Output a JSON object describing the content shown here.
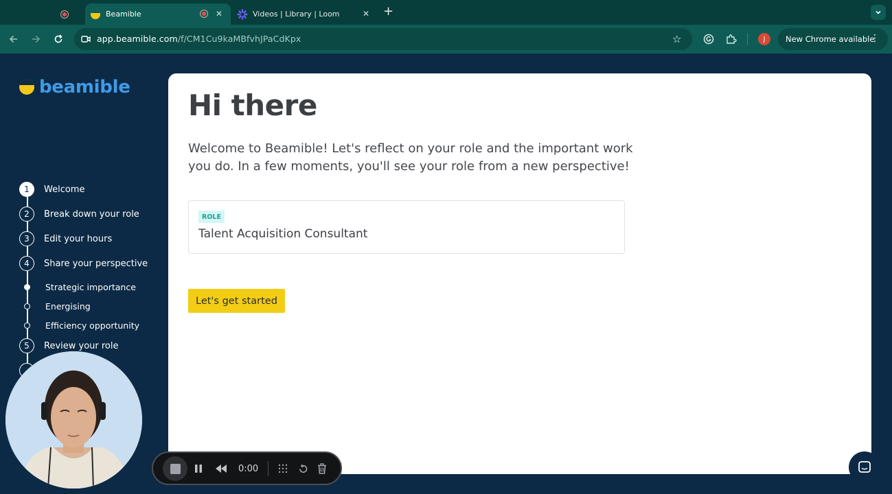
{
  "browser": {
    "tabs": [
      {
        "title": "Beamible",
        "active": true
      },
      {
        "title": "Videos | Library | Loom",
        "active": false
      }
    ],
    "url_host": "app.beamible.com",
    "url_path": "/f/CM1Cu9kaMBfvhJPaCdKpx",
    "profile_initial": "J",
    "update_label": "New Chrome available"
  },
  "app": {
    "logo_text": "beamible",
    "steps": [
      {
        "num": "1",
        "label": "Welcome"
      },
      {
        "num": "2",
        "label": "Break down your role"
      },
      {
        "num": "3",
        "label": "Edit your hours"
      },
      {
        "num": "4",
        "label": "Share your perspective"
      },
      {
        "num": "5",
        "label": "Review your role"
      }
    ],
    "substeps": [
      {
        "label": "Strategic importance"
      },
      {
        "label": "Energising"
      },
      {
        "label": "Efficiency opportunity"
      }
    ],
    "heading": "Hi there",
    "welcome_text": "Welcome to Beamible! Let's reflect on your role and the important work you do. In a few moments, you'll see your role from a new perspective!",
    "role_badge": "ROLE",
    "role_value": "Talent Acquisition Consultant",
    "cta_label": "Let's get started"
  },
  "recorder": {
    "time": "0:00"
  },
  "colors": {
    "brand_blue": "#3f9be8",
    "brand_yellow": "#f2c81b",
    "sidebar_bg": "#0c2a45",
    "chrome_green": "#0e5c55"
  }
}
